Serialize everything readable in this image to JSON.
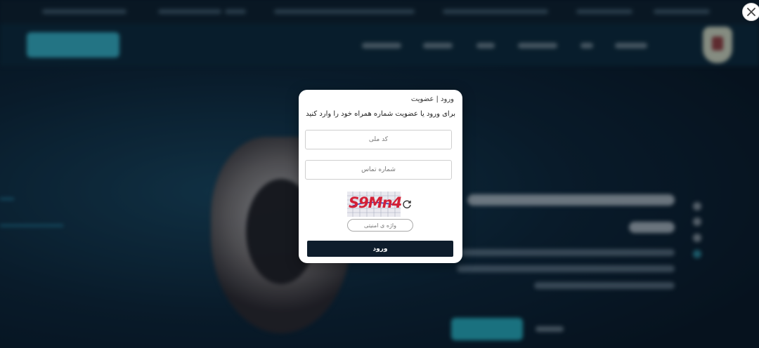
{
  "modal": {
    "title": "ورود | عضویت",
    "description": "برای ورود یا عضویت شماره همراه خود را وارد کنید",
    "national_code_placeholder": "کد ملی",
    "phone_placeholder": "شماره تماس",
    "captcha_text": "S9Mn4",
    "security_word_placeholder": "واژه ی امنیتی",
    "submit_label": "ورود"
  },
  "colors": {
    "submit_bg": "#0e1d2c",
    "captcha_text": "#d42036",
    "accent_cyan": "#3cc3d6"
  },
  "icons": {
    "close": "close-icon",
    "refresh": "refresh-icon",
    "captcha": "captcha-image"
  }
}
